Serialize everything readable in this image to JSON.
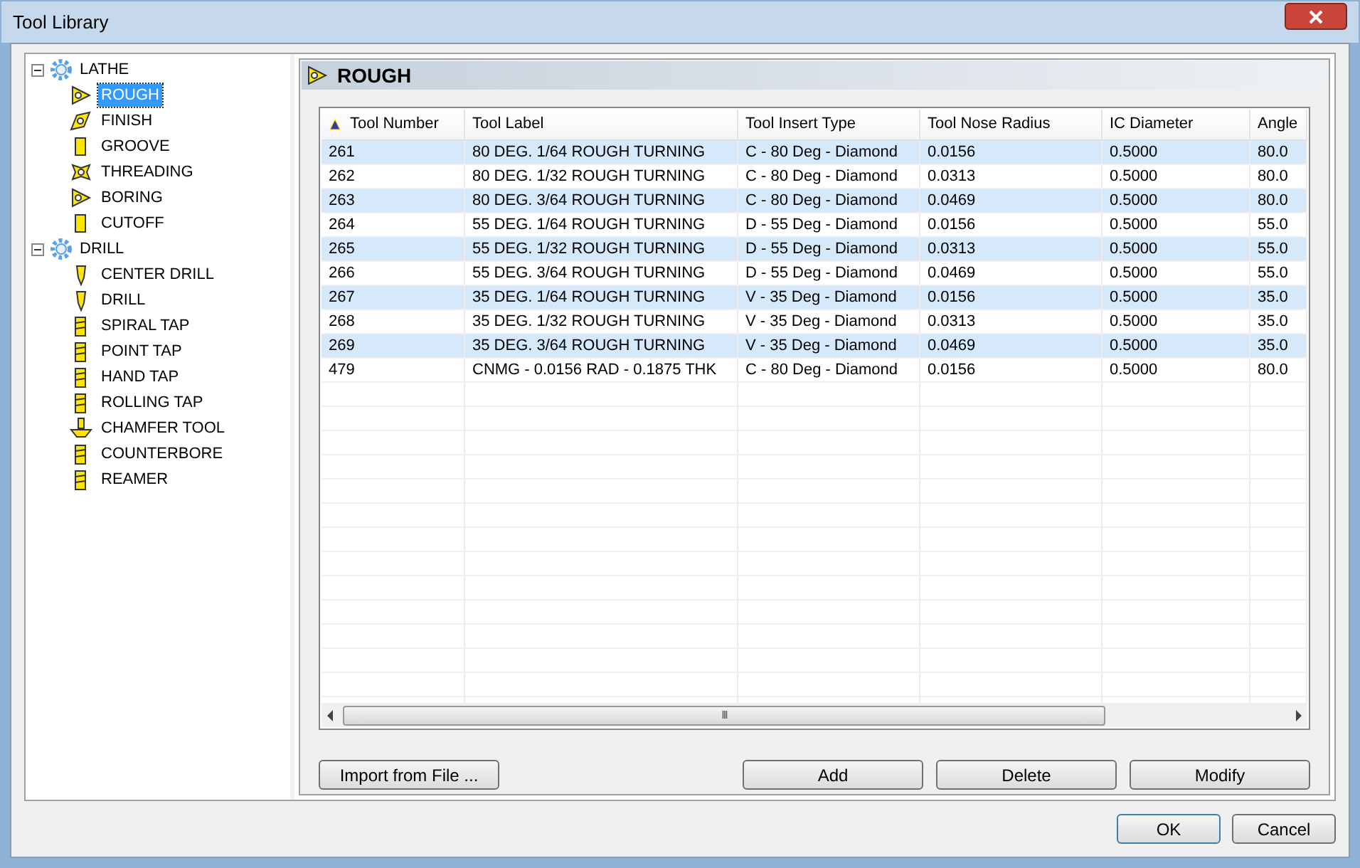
{
  "window": {
    "title": "Tool Library"
  },
  "tree": [
    {
      "label": "LATHE",
      "expanded": true,
      "selected": false,
      "children": [
        {
          "label": "ROUGH",
          "kind": "triangle",
          "selected": true
        },
        {
          "label": "FINISH",
          "kind": "diamond",
          "selected": false
        },
        {
          "label": "GROOVE",
          "kind": "bar",
          "selected": false
        },
        {
          "label": "THREADING",
          "kind": "star",
          "selected": false
        },
        {
          "label": "BORING",
          "kind": "triangle",
          "selected": false
        },
        {
          "label": "CUTOFF",
          "kind": "bar",
          "selected": false
        }
      ]
    },
    {
      "label": "DRILL",
      "expanded": true,
      "selected": false,
      "children": [
        {
          "label": "CENTER DRILL",
          "kind": "drill",
          "selected": false
        },
        {
          "label": "DRILL",
          "kind": "drill",
          "selected": false
        },
        {
          "label": "SPIRAL TAP",
          "kind": "tap",
          "selected": false
        },
        {
          "label": "POINT TAP",
          "kind": "tap",
          "selected": false
        },
        {
          "label": "HAND TAP",
          "kind": "tap",
          "selected": false
        },
        {
          "label": "ROLLING TAP",
          "kind": "tap",
          "selected": false
        },
        {
          "label": "CHAMFER TOOL",
          "kind": "chamfer",
          "selected": false
        },
        {
          "label": "COUNTERBORE",
          "kind": "tap",
          "selected": false
        },
        {
          "label": "REAMER",
          "kind": "tap",
          "selected": false
        }
      ]
    }
  ],
  "panel": {
    "title": "ROUGH"
  },
  "table": {
    "columns": [
      "Tool Number",
      "Tool Label",
      "Tool Insert Type",
      "Tool Nose Radius",
      "IC Diameter",
      "Angle"
    ],
    "rows": [
      [
        "261",
        "80 DEG.  1/64 ROUGH TURNING",
        "C - 80 Deg - Diamond",
        "0.0156",
        "0.5000",
        "80.0"
      ],
      [
        "262",
        "80 DEG.  1/32 ROUGH TURNING",
        "C - 80 Deg - Diamond",
        "0.0313",
        "0.5000",
        "80.0"
      ],
      [
        "263",
        "80 DEG.  3/64 ROUGH TURNING",
        "C - 80 Deg - Diamond",
        "0.0469",
        "0.5000",
        "80.0"
      ],
      [
        "264",
        "55 DEG.  1/64 ROUGH TURNING",
        "D - 55 Deg - Diamond",
        "0.0156",
        "0.5000",
        "55.0"
      ],
      [
        "265",
        "55 DEG.  1/32 ROUGH TURNING",
        "D - 55 Deg - Diamond",
        "0.0313",
        "0.5000",
        "55.0"
      ],
      [
        "266",
        "55 DEG.  3/64 ROUGH TURNING",
        "D - 55 Deg - Diamond",
        "0.0469",
        "0.5000",
        "55.0"
      ],
      [
        "267",
        "35 DEG.  1/64 ROUGH TURNING",
        "V - 35 Deg - Diamond",
        "0.0156",
        "0.5000",
        "35.0"
      ],
      [
        "268",
        "35 DEG.  1/32 ROUGH TURNING",
        "V - 35 Deg - Diamond",
        "0.0313",
        "0.5000",
        "35.0"
      ],
      [
        "269",
        "35 DEG.  3/64 ROUGH TURNING",
        "V - 35 Deg - Diamond",
        "0.0469",
        "0.5000",
        "35.0"
      ],
      [
        "479",
        "CNMG - 0.0156 RAD - 0.1875 THK",
        "C - 80 Deg - Diamond",
        "0.0156",
        "0.5000",
        "80.0"
      ]
    ]
  },
  "scroll_grip": "III",
  "actions": [
    "Import from File ...",
    "Add",
    "Delete",
    "Modify"
  ],
  "dialog_buttons": [
    "OK",
    "Cancel"
  ]
}
